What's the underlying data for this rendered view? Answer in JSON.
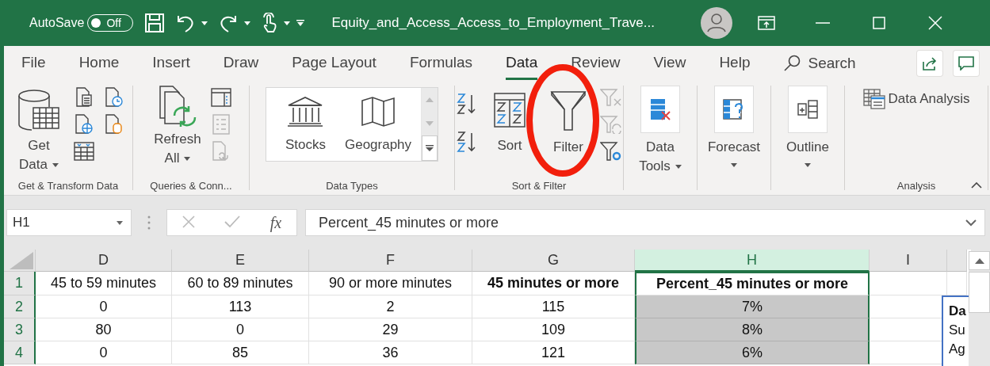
{
  "title_bar": {
    "autosave": {
      "label": "AutoSave",
      "toggle": "Off",
      "on": false
    },
    "file_title": "Equity_and_Access_Access_to_Employment_Trave..."
  },
  "tabs": [
    {
      "label": "File",
      "selected": false
    },
    {
      "label": "Home",
      "selected": false
    },
    {
      "label": "Insert",
      "selected": false
    },
    {
      "label": "Draw",
      "selected": false
    },
    {
      "label": "Page Layout",
      "selected": false
    },
    {
      "label": "Formulas",
      "selected": false
    },
    {
      "label": "Data",
      "selected": true
    },
    {
      "label": "Review",
      "selected": false
    },
    {
      "label": "View",
      "selected": false
    },
    {
      "label": "Help",
      "selected": false
    }
  ],
  "search": {
    "label": "Search"
  },
  "ribbon": {
    "groups": [
      {
        "kind": "get",
        "label": "Get & Transform Data",
        "button": {
          "label": "Get Data",
          "dropdown": true
        }
      },
      {
        "kind": "queries",
        "label": "Queries & Conn...",
        "button": {
          "label": "Refresh All",
          "dropdown": true
        },
        "small": [
          {
            "disabled": false
          },
          {
            "disabled": true
          },
          {
            "disabled": true
          }
        ]
      },
      {
        "kind": "types",
        "label": "Data Types",
        "items": [
          "Stocks",
          "Geography"
        ]
      },
      {
        "kind": "sort",
        "label": "Sort & Filter",
        "buttons": [
          "Sort",
          "Filter"
        ],
        "small": [
          {
            "disabled": true
          },
          {
            "disabled": true
          },
          {
            "disabled": false
          }
        ]
      },
      {
        "kind": "tool",
        "button": {
          "label": "Data Tools",
          "dropdown": true
        }
      },
      {
        "kind": "tool",
        "button": {
          "label": "Forecast",
          "dropdown": true
        }
      },
      {
        "kind": "tool",
        "button": {
          "label": "Outline",
          "dropdown": true
        }
      },
      {
        "kind": "analysis",
        "label": "Analysis",
        "button": {
          "label": "Data Analysis"
        }
      }
    ]
  },
  "formula_bar": {
    "name_box": "H1",
    "fx": "fx",
    "value": "Percent_45 minutes or more"
  },
  "sheet": {
    "columns": [
      {
        "label": "D",
        "selected": false
      },
      {
        "label": "E",
        "selected": false
      },
      {
        "label": "F",
        "selected": false
      },
      {
        "label": "G",
        "selected": false
      },
      {
        "label": "H",
        "selected": true
      },
      {
        "label": "I",
        "selected": false
      }
    ],
    "rows": [
      {
        "label": "1",
        "cells": [
          {
            "text": "45 to 59 minutes",
            "bold": false,
            "shaded": false
          },
          {
            "text": "60 to 89 minutes",
            "bold": false,
            "shaded": false
          },
          {
            "text": "90 or more minutes",
            "bold": false,
            "shaded": false
          },
          {
            "text": "45 minutes or more",
            "bold": true,
            "shaded": false
          },
          {
            "text": "Percent_45 minutes or more",
            "bold": true,
            "shaded": false
          }
        ]
      },
      {
        "label": "2",
        "cells": [
          {
            "text": "0",
            "bold": false,
            "shaded": false
          },
          {
            "text": "113",
            "bold": false,
            "shaded": false
          },
          {
            "text": "2",
            "bold": false,
            "shaded": false
          },
          {
            "text": "115",
            "bold": false,
            "shaded": false
          },
          {
            "text": "7%",
            "bold": false,
            "shaded": true
          }
        ]
      },
      {
        "label": "3",
        "cells": [
          {
            "text": "80",
            "bold": false,
            "shaded": false
          },
          {
            "text": "0",
            "bold": false,
            "shaded": false
          },
          {
            "text": "29",
            "bold": false,
            "shaded": false
          },
          {
            "text": "109",
            "bold": false,
            "shaded": false
          },
          {
            "text": "8%",
            "bold": false,
            "shaded": true
          }
        ]
      },
      {
        "label": "4",
        "cells": [
          {
            "text": "0",
            "bold": false,
            "shaded": false
          },
          {
            "text": "85",
            "bold": false,
            "shaded": false
          },
          {
            "text": "36",
            "bold": false,
            "shaded": false
          },
          {
            "text": "121",
            "bold": false,
            "shaded": false
          },
          {
            "text": "6%",
            "bold": false,
            "shaded": true
          }
        ]
      }
    ],
    "text_box": {
      "lines": [
        {
          "text": "Da",
          "bold": true
        },
        {
          "text": "Su",
          "bold": false
        },
        {
          "text": "Ag",
          "bold": false
        }
      ]
    }
  }
}
